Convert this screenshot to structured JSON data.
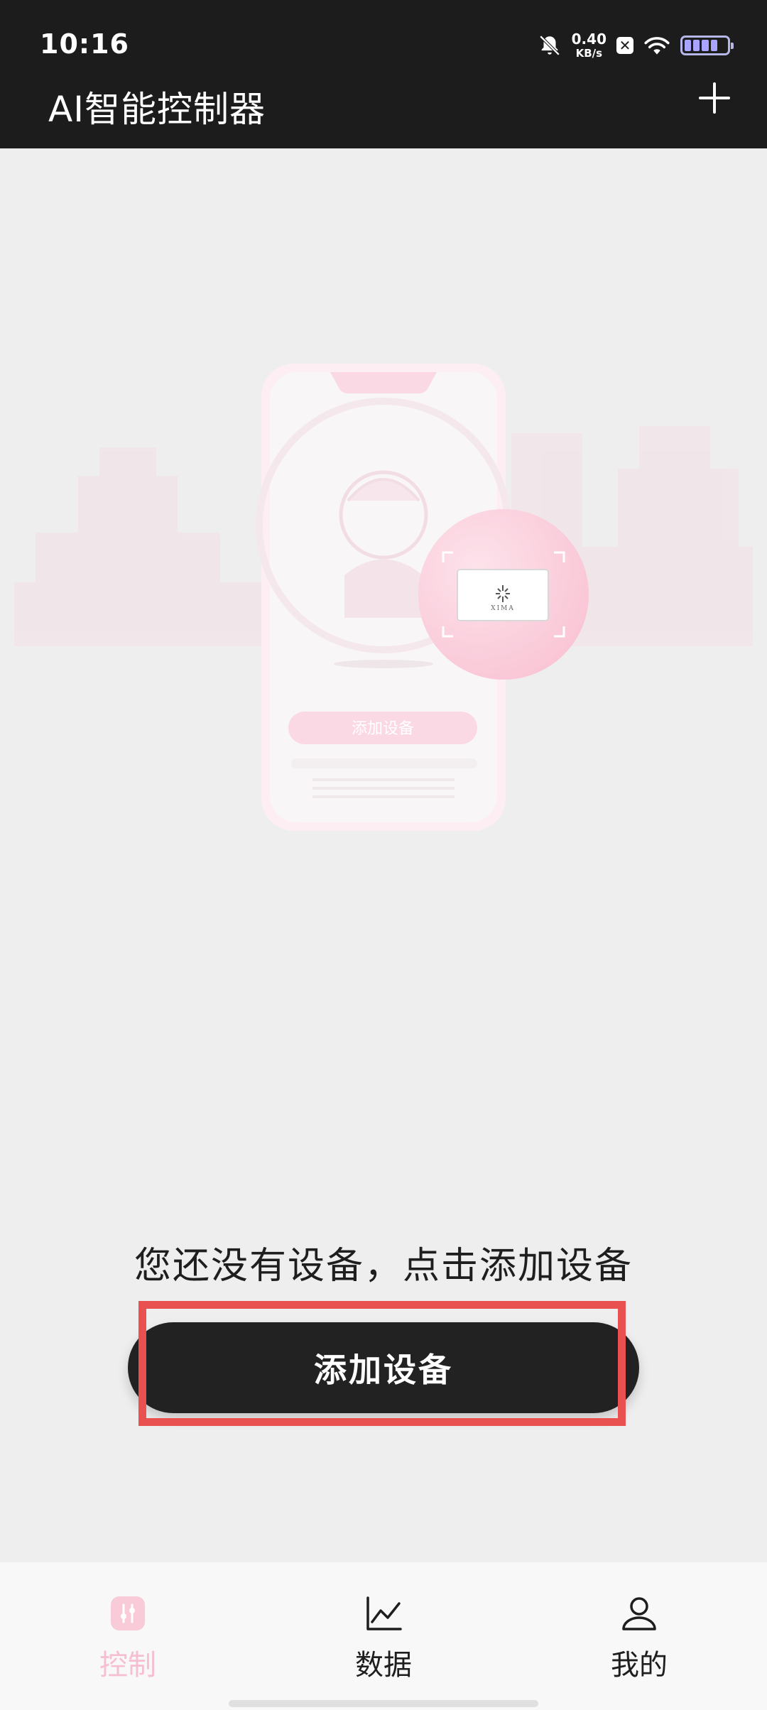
{
  "status_bar": {
    "time": "10:16",
    "net_speed_value": "0.40",
    "net_speed_unit": "KB/s",
    "icons": [
      "bell-off-icon",
      "x-app-icon",
      "wifi-icon",
      "battery-icon"
    ]
  },
  "app_bar": {
    "title": "AI智能控制器",
    "add_icon": "plus-icon"
  },
  "illustration": {
    "phone_button_label": "添加设备",
    "device_label": "XIMA"
  },
  "empty_state": {
    "message": "您还没有设备，点击添加设备",
    "button_label": "添加设备"
  },
  "bottom_nav": {
    "items": [
      {
        "label": "控制",
        "icon": "control-sliders-icon",
        "active": true
      },
      {
        "label": "数据",
        "icon": "chart-line-icon",
        "active": false
      },
      {
        "label": "我的",
        "icon": "user-icon",
        "active": false
      }
    ]
  },
  "colors": {
    "top_bar": "#1c1c1c",
    "background": "#efeeef",
    "accent_pink": "#f6bfd1",
    "button": "#222222",
    "highlight": "#e8514f"
  }
}
